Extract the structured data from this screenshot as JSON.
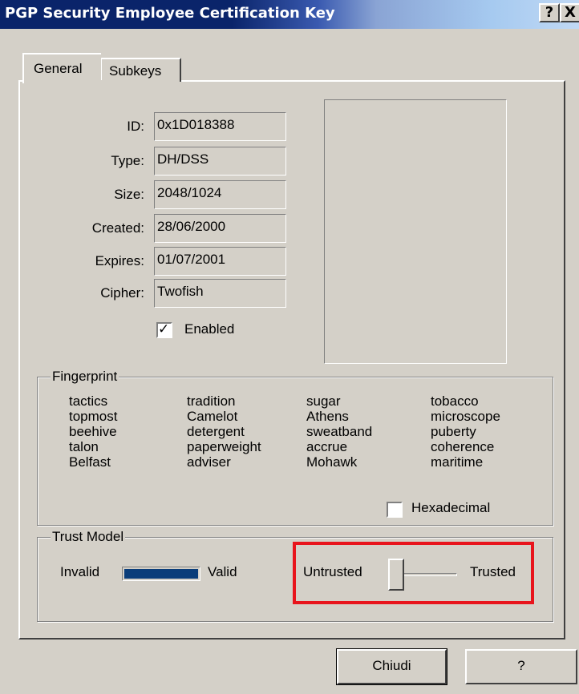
{
  "window": {
    "title": "PGP Security Employee Certification Key",
    "help_glyph": "?",
    "close_glyph": "X"
  },
  "tabs": [
    {
      "label": "General"
    },
    {
      "label": "Subkeys"
    }
  ],
  "fields": [
    {
      "label": "ID:",
      "value": "0x1D018388"
    },
    {
      "label": "Type:",
      "value": "DH/DSS"
    },
    {
      "label": "Size:",
      "value": "2048/1024"
    },
    {
      "label": "Created:",
      "value": "28/06/2000"
    },
    {
      "label": "Expires:",
      "value": "01/07/2001"
    },
    {
      "label": "Cipher:",
      "value": "Twofish"
    }
  ],
  "enabled": {
    "label": "Enabled",
    "checked": true,
    "mark": "✓"
  },
  "fingerprint": {
    "title": "Fingerprint",
    "columns": [
      [
        "tactics",
        "topmost",
        "beehive",
        "talon",
        "Belfast"
      ],
      [
        "tradition",
        "Camelot",
        "detergent",
        "paperweight",
        "adviser"
      ],
      [
        "sugar",
        "Athens",
        "sweatband",
        "accrue",
        "Mohawk"
      ],
      [
        "tobacco",
        "microscope",
        "puberty",
        "coherence",
        "maritime"
      ]
    ],
    "hex_label": "Hexadecimal",
    "hex_checked": false
  },
  "trust": {
    "title": "Trust Model",
    "validity_left": "Invalid",
    "validity_right": "Valid",
    "trust_left": "Untrusted",
    "trust_right": "Trusted",
    "validity_fill": 1.0,
    "trust_level": 0.0,
    "bar_color": "#0a3d7a"
  },
  "buttons": {
    "close": "Chiudi",
    "help": "?"
  },
  "highlight_color": "#e8141c"
}
